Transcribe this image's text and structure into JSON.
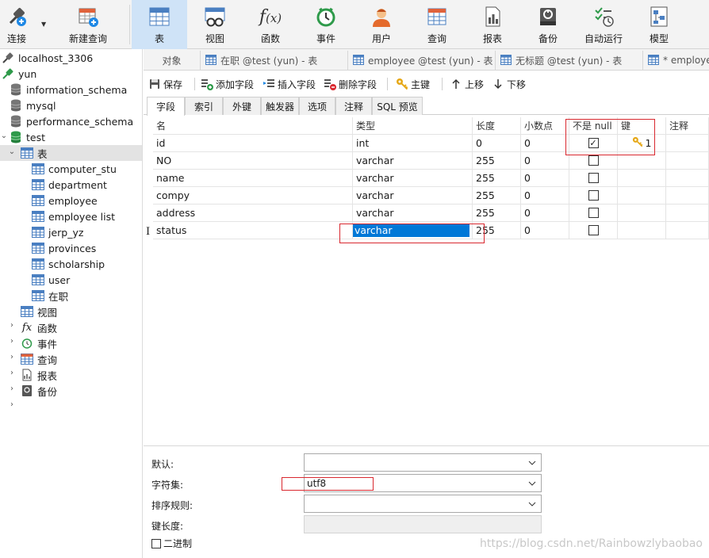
{
  "ribbon": {
    "buttons": [
      {
        "label": "连接",
        "icon": "connect-icon"
      },
      {
        "label": "新建查询",
        "icon": "new-query-icon"
      },
      {
        "label": "表",
        "icon": "table-icon",
        "active": true
      },
      {
        "label": "视图",
        "icon": "view-icon"
      },
      {
        "label": "函数",
        "icon": "function-icon"
      },
      {
        "label": "事件",
        "icon": "event-icon"
      },
      {
        "label": "用户",
        "icon": "user-icon"
      },
      {
        "label": "查询",
        "icon": "query-icon"
      },
      {
        "label": "报表",
        "icon": "report-icon"
      },
      {
        "label": "备份",
        "icon": "backup-icon"
      },
      {
        "label": "自动运行",
        "icon": "autorun-icon"
      },
      {
        "label": "模型",
        "icon": "model-icon"
      }
    ]
  },
  "tree": {
    "connection": "localhost_3306",
    "connection2": "yun",
    "databases": [
      "information_schema",
      "mysql",
      "performance_schema",
      "test"
    ],
    "tables_label": "表",
    "tables": [
      "computer_stu",
      "department",
      "employee",
      "employee list",
      "jerp_yz",
      "provinces",
      "scholarship",
      "user",
      "在职"
    ],
    "groups": [
      "视图",
      "函数",
      "事件",
      "查询",
      "报表",
      "备份"
    ]
  },
  "object_tabs": [
    "对象",
    "在职 @test (yun) - 表",
    "employee @test (yun) - 表",
    "无标题 @test (yun) - 表",
    "* employe"
  ],
  "actions": {
    "save": "保存",
    "add_field": "添加字段",
    "insert_field": "插入字段",
    "delete_field": "删除字段",
    "primary_key": "主键",
    "move_up": "上移",
    "move_down": "下移"
  },
  "sub_tabs": [
    "字段",
    "索引",
    "外键",
    "触发器",
    "选项",
    "注释",
    "SQL 预览"
  ],
  "grid": {
    "headers": [
      "名",
      "类型",
      "长度",
      "小数点",
      "不是 null",
      "键",
      "注释"
    ],
    "rows": [
      {
        "name": "id",
        "type": "int",
        "length": "0",
        "decimals": "0",
        "not_null": true,
        "key": "1"
      },
      {
        "name": "NO",
        "type": "varchar",
        "length": "255",
        "decimals": "0",
        "not_null": false,
        "key": ""
      },
      {
        "name": "name",
        "type": "varchar",
        "length": "255",
        "decimals": "0",
        "not_null": false,
        "key": ""
      },
      {
        "name": "compy",
        "type": "varchar",
        "length": "255",
        "decimals": "0",
        "not_null": false,
        "key": ""
      },
      {
        "name": "address",
        "type": "varchar",
        "length": "255",
        "decimals": "0",
        "not_null": false,
        "key": ""
      },
      {
        "name": "status",
        "type": "varchar",
        "length": "255",
        "decimals": "0",
        "not_null": false,
        "key": ""
      }
    ],
    "selection_color": "#0078d7",
    "highlight_color": "#d9282f"
  },
  "properties": {
    "default_label": "默认:",
    "default_value": "",
    "charset_label": "字符集:",
    "charset_value": "utf8",
    "collation_label": "排序规则:",
    "collation_value": "",
    "keylen_label": "键长度:",
    "binary_label": "二进制"
  },
  "watermark": "https://blog.csdn.net/Rainbowzlybaobao"
}
